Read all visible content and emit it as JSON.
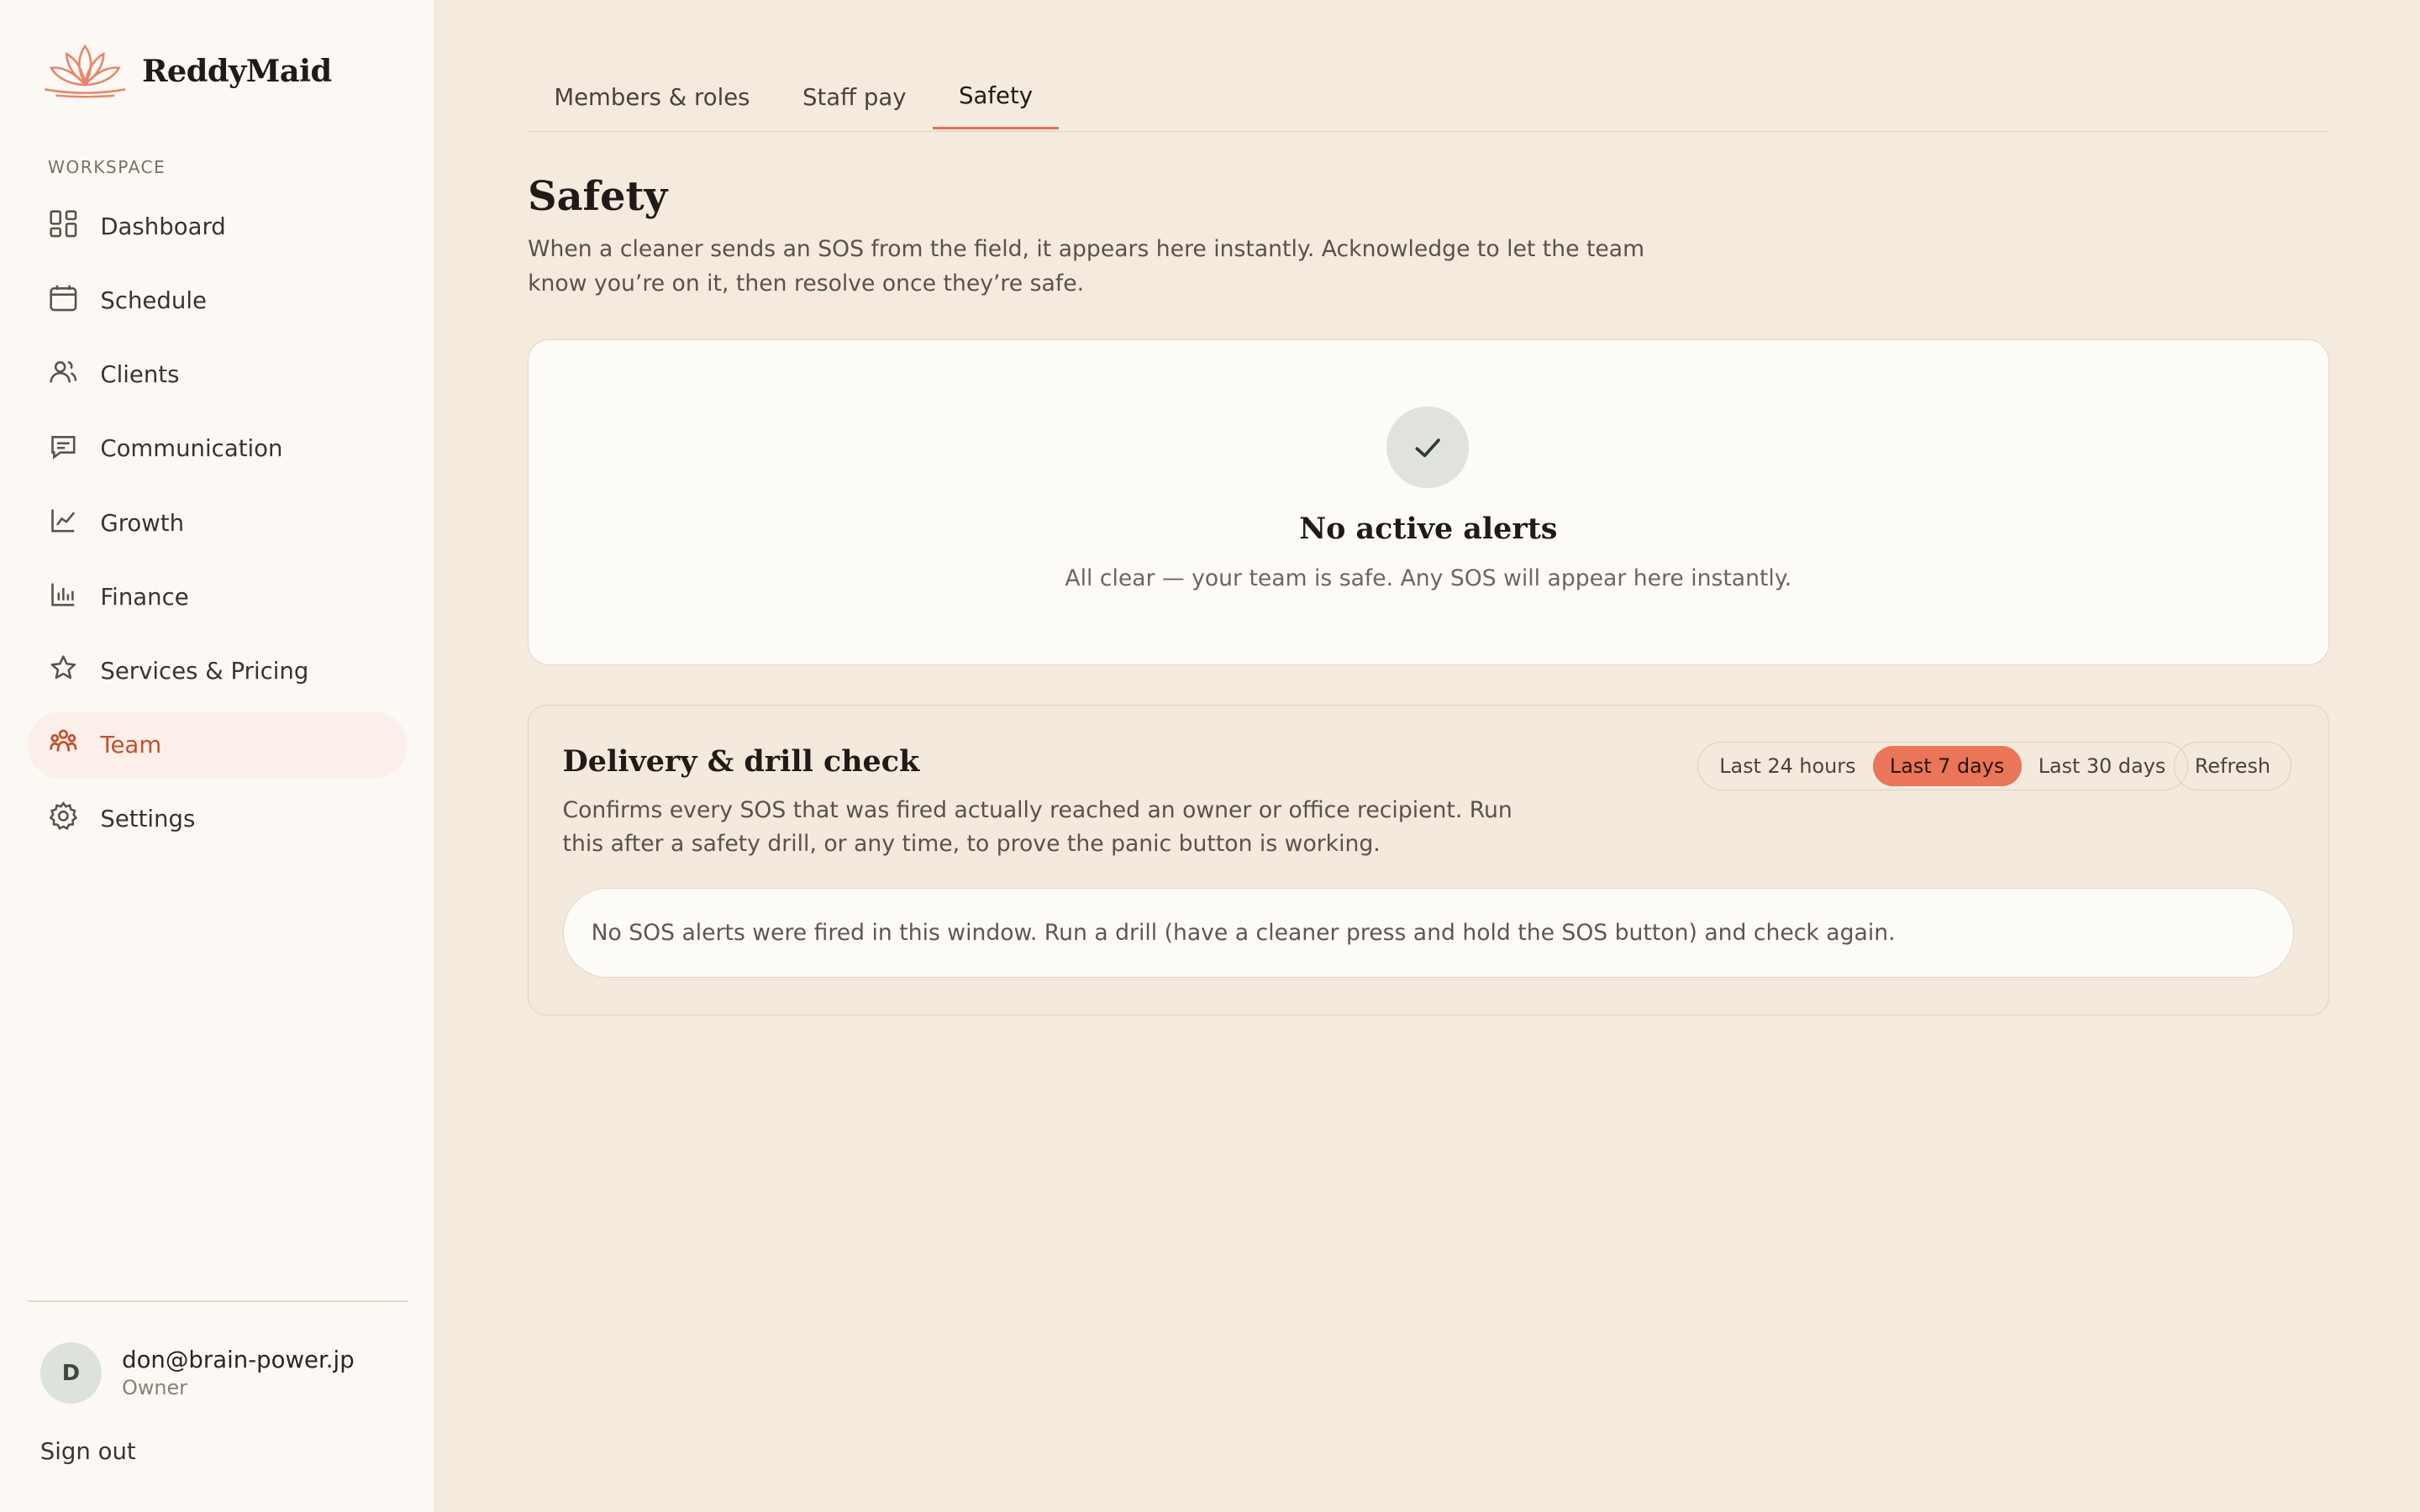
{
  "brand": {
    "name": "ReddyMaid",
    "logo_icon": "lotus-icon",
    "accent": "#e4714f"
  },
  "sidebar": {
    "section_label": "WORKSPACE",
    "items": [
      {
        "label": "Dashboard",
        "icon": "grid-icon",
        "active": false
      },
      {
        "label": "Schedule",
        "icon": "calendar-icon",
        "active": false
      },
      {
        "label": "Clients",
        "icon": "users-icon",
        "active": false
      },
      {
        "label": "Communication",
        "icon": "message-icon",
        "active": false
      },
      {
        "label": "Growth",
        "icon": "trend-icon",
        "active": false
      },
      {
        "label": "Finance",
        "icon": "bar-chart-icon",
        "active": false
      },
      {
        "label": "Services & Pricing",
        "icon": "star-icon",
        "active": false
      },
      {
        "label": "Team",
        "icon": "team-icon",
        "active": true
      },
      {
        "label": "Settings",
        "icon": "gear-icon",
        "active": false
      }
    ],
    "user": {
      "initial": "D",
      "email": "don@brain-power.jp",
      "role": "Owner"
    },
    "sign_out": "Sign out"
  },
  "tabs": [
    {
      "label": "Members & roles",
      "active": false
    },
    {
      "label": "Staff pay",
      "active": false
    },
    {
      "label": "Safety",
      "active": true
    }
  ],
  "page": {
    "title": "Safety",
    "description": "When a cleaner sends an SOS from the field, it appears here instantly. Acknowledge to let the team know you’re on it, then resolve once they’re safe."
  },
  "alerts": {
    "icon": "check-icon",
    "title": "No active alerts",
    "subtitle": "All clear — your team is safe. Any SOS will appear here instantly."
  },
  "drill": {
    "title": "Delivery & drill check",
    "description": "Confirms every SOS that was fired actually reached an owner or office recipient. Run this after a safety drill, or any time, to prove the panic button is working.",
    "ranges": [
      {
        "label": "Last 24 hours",
        "selected": false
      },
      {
        "label": "Last 7 days",
        "selected": true
      },
      {
        "label": "Last 30 days",
        "selected": false
      }
    ],
    "refresh_label": "Refresh",
    "empty_message": "No SOS alerts were fired in this window. Run a drill (have a cleaner press and hold the SOS button) and check again."
  }
}
